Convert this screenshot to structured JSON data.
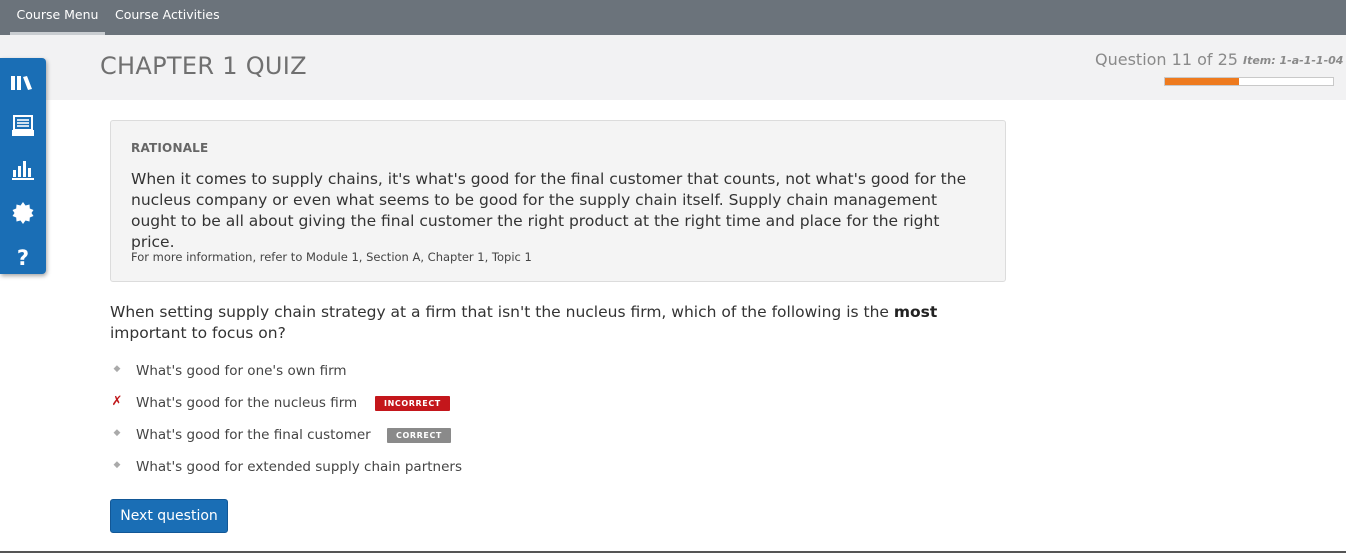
{
  "topnav": {
    "tabs": [
      {
        "label": "Course Menu",
        "active": true
      },
      {
        "label": "Course Activities",
        "active": false
      }
    ]
  },
  "header": {
    "title": "CHAPTER 1 QUIZ",
    "question_counter": "Question 11 of 25",
    "item_id": "Item: 1-a-1-1-04",
    "progress_fraction": 0.44
  },
  "sidebar": {
    "icons": [
      "books-icon",
      "inbox-icon",
      "bar-chart-icon",
      "gear-icon",
      "help-icon"
    ]
  },
  "rationale": {
    "title": "RATIONALE",
    "text": "When it comes to supply chains, it's what's good for the final customer that counts, not what's good for the nucleus company or even what seems to be good for the supply chain itself. Supply chain management ought to be all about giving the final customer the right product at the right time and place for the right price.",
    "reference": "For more information, refer to Module 1, Section A, Chapter 1, Topic 1"
  },
  "question": {
    "text_before": "When setting supply chain strategy at a firm that isn't the nucleus firm, which of the following is the ",
    "emphasis": "most",
    "text_after": " important to focus on?"
  },
  "options": [
    {
      "text": "What's good for one's own firm",
      "marker": "◆",
      "badge": ""
    },
    {
      "text": "What's good for the nucleus firm",
      "marker": "✗",
      "badge": "INCORRECT"
    },
    {
      "text": "What's good for the final customer",
      "marker": "◆",
      "badge": "CORRECT"
    },
    {
      "text": "What's good for extended supply chain partners",
      "marker": "◆",
      "badge": ""
    }
  ],
  "actions": {
    "next_label": "Next question"
  },
  "colors": {
    "accent": "#1a6eb5",
    "progress": "#ee7a1e",
    "incorrect": "#c4161b",
    "correct": "#8a8a8a"
  }
}
